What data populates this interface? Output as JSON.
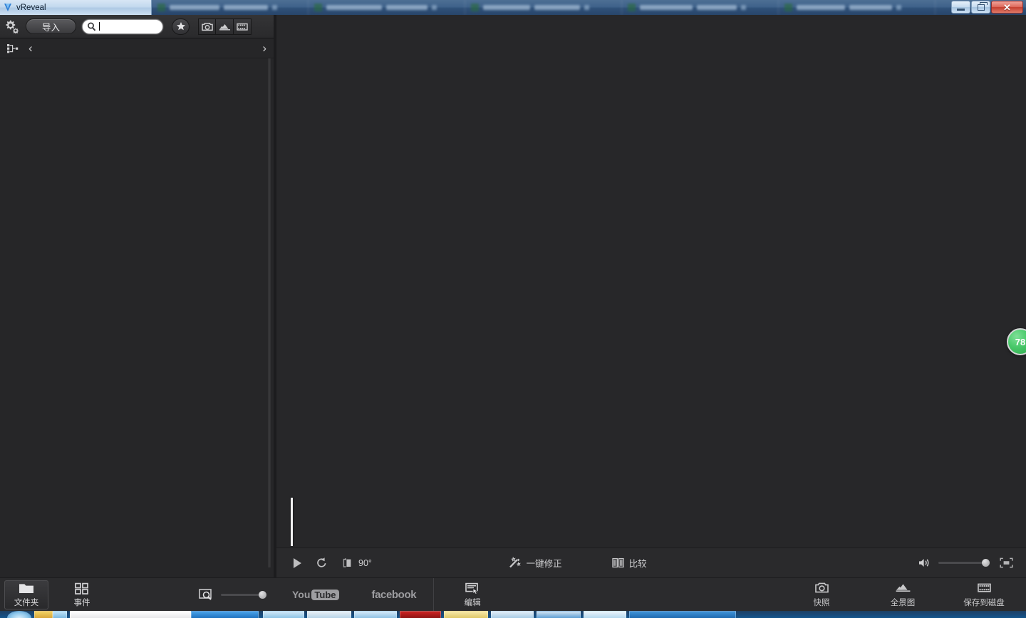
{
  "titlebar": {
    "app_title": "vReveal",
    "logo_icon": "vreveal-logo-icon",
    "minimize_label": "",
    "restore_label": "",
    "close_label": "✕"
  },
  "library_toolbar": {
    "settings_icon": "gear-icon",
    "import_label": "导入",
    "search": {
      "value": "",
      "placeholder": "",
      "icon": "search-icon"
    },
    "filters": [
      {
        "name": "favorites-filter",
        "icon": "star-icon"
      },
      {
        "name": "photos-filter",
        "icon": "camera-icon"
      },
      {
        "name": "panorama-filter",
        "icon": "mountain-icon"
      },
      {
        "name": "videos-filter",
        "icon": "film-strip-icon"
      }
    ]
  },
  "library_nav": {
    "tree_icon": "hierarchy-tree-icon",
    "back_label": "‹",
    "forward_label": "›"
  },
  "viewer": {
    "quality_badge": "78"
  },
  "player_controls": {
    "play_icon": "play-icon",
    "rotate_icon": "rotate-ccw-icon",
    "crop_icon": "crop-rotate-icon",
    "rotation_value": "90°",
    "autofix_label": "一键修正",
    "autofix_icon": "magic-wand-icon",
    "compare_label": "比较",
    "compare_icon": "split-compare-icon",
    "volume_icon": "speaker-icon",
    "volume_percent": 85,
    "fullscreen_icon": "fullscreen-icon"
  },
  "bottom_bar": {
    "tabs": [
      {
        "label": "文件夹",
        "icon": "folder-icon",
        "active": true
      },
      {
        "label": "事件",
        "icon": "grid-icon",
        "active": false
      }
    ],
    "thumb_zoom": {
      "icon": "zoom-thumbnail-icon",
      "percent": 100
    },
    "social": [
      {
        "name": "youtube",
        "part1": "You",
        "part2": "Tube"
      },
      {
        "name": "facebook",
        "label": "facebook"
      }
    ],
    "edit": {
      "label": "编辑",
      "icon": "edit-panel-icon"
    },
    "actions": [
      {
        "label": "快照",
        "icon": "camera-icon"
      },
      {
        "label": "全景图",
        "icon": "panorama-icon"
      },
      {
        "label": "保存到磁盘",
        "icon": "save-disk-icon"
      }
    ]
  },
  "taskbar": {
    "start_orb": "windows-start-orb"
  },
  "colors": {
    "panel_bg": "#262628",
    "viewer_bg": "#272729",
    "control_bg": "#2a2a2c",
    "badge_green": "#2da74c",
    "titlebar_blue": "#2f5179"
  }
}
